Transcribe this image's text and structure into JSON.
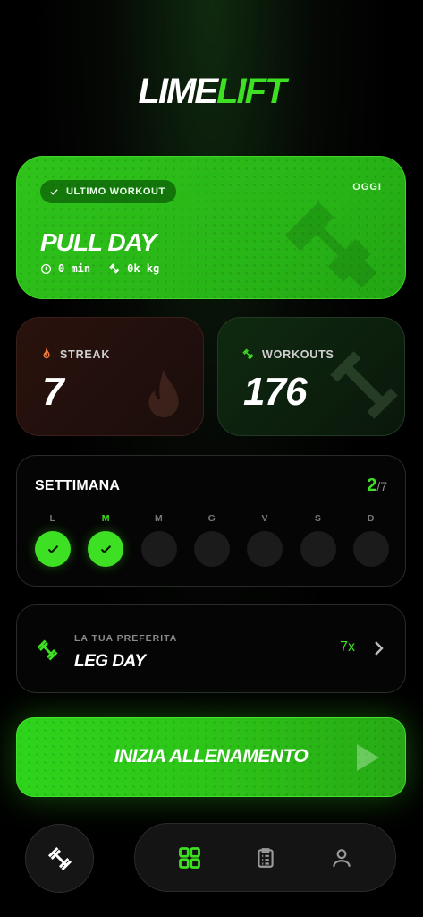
{
  "brand": {
    "part1": "LIME",
    "part2": "LIFT"
  },
  "last_workout": {
    "badge": "ULTIMO WORKOUT",
    "day_label": "OGGI",
    "title": "PULL DAY",
    "duration": "0 min",
    "volume": "0k kg"
  },
  "stats": {
    "streak": {
      "label": "STREAK",
      "value": "7",
      "icon": "flame-icon"
    },
    "workouts": {
      "label": "WORKOUTS",
      "value": "176",
      "icon": "dumbbell-icon"
    }
  },
  "week": {
    "title": "SETTIMANA",
    "done": "2",
    "total": "/7",
    "days": [
      {
        "letter": "L",
        "done": true
      },
      {
        "letter": "M",
        "done": true,
        "today": true
      },
      {
        "letter": "M",
        "done": false
      },
      {
        "letter": "G",
        "done": false
      },
      {
        "letter": "V",
        "done": false
      },
      {
        "letter": "S",
        "done": false
      },
      {
        "letter": "D",
        "done": false
      }
    ]
  },
  "favorite": {
    "caption": "LA TUA PREFERITA",
    "name": "LEG DAY",
    "count": "7x"
  },
  "start_button": {
    "label": "INIZIA ALLENAMENTO"
  },
  "colors": {
    "accent": "#3de022",
    "background": "#000000",
    "card": "#050505"
  },
  "nav": {
    "items": [
      "dashboard-icon",
      "clipboard-list-icon",
      "user-icon"
    ],
    "active": "dashboard-icon"
  }
}
